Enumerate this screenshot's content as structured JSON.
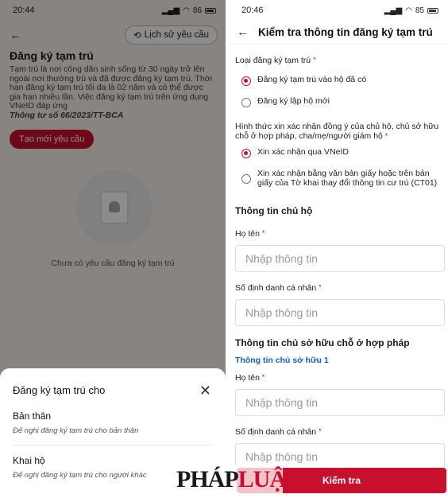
{
  "left": {
    "status": {
      "time": "20:44",
      "battery": "86"
    },
    "history_button": "Lịch sử yêu cầu",
    "title": "Đăng ký tạm trú",
    "description": "Tạm trú là nơi công dân sinh sống từ 30 ngày trở lên ngoài nơi thường trú và đã được đăng ký tạm trú. Thời hạn đăng ký tạm trú tối đa là 02 năm và có thể được gia hạn nhiều lần. Việc đăng ký tạm trú trên ứng dụng VNeID đáp ứng",
    "reference": "Thông tư số 66/2023/TT-BCA",
    "create_button": "Tạo mới yêu cầu",
    "empty_text": "Chưa có yêu cầu đăng ký tạm trú",
    "sheet": {
      "title": "Đăng ký tạm trú cho",
      "items": [
        {
          "title": "Bản thân",
          "subtitle": "Để nghị đăng ký tạm trú cho bản thân"
        },
        {
          "title": "Khai hộ",
          "subtitle": "Để nghị đăng ký tạm trú cho người khác"
        }
      ]
    }
  },
  "right": {
    "status": {
      "time": "20:46",
      "battery": "85"
    },
    "header_title": "Kiểm tra thông tin đăng ký tạm trú",
    "type_label": "Loại đăng ký tạm trú",
    "type_options": [
      "Đăng ký tạm trú vào hộ đã có",
      "Đăng ký lập hộ mới"
    ],
    "method_label": "Hình thức xin xác nhận đồng ý của chủ hộ, chủ sở hữu chỗ ở hợp pháp, cha/mẹ/người giám hộ",
    "method_options": [
      "Xin xác nhận qua VNeID",
      "Xin xác nhận bằng văn bản giấy hoặc trên bản giấy của Tờ khai thay đổi thông tin cư trú (CT01)"
    ],
    "owner_section": "Thông tin chủ hộ",
    "name_label": "Họ tên",
    "id_label": "Số định danh cá nhân",
    "placeholder": "Nhập thông tin",
    "property_section": "Thông tin chủ sở hữu chỗ ở hợp pháp",
    "property_owner_link": "Thông tin chủ sở hữu 1",
    "check_button": "Kiểm tra"
  },
  "watermark": {
    "part1": "PHÁP",
    "part2": "LUẬT"
  },
  "colors": {
    "accent": "#c8102e",
    "link": "#1560bd"
  }
}
